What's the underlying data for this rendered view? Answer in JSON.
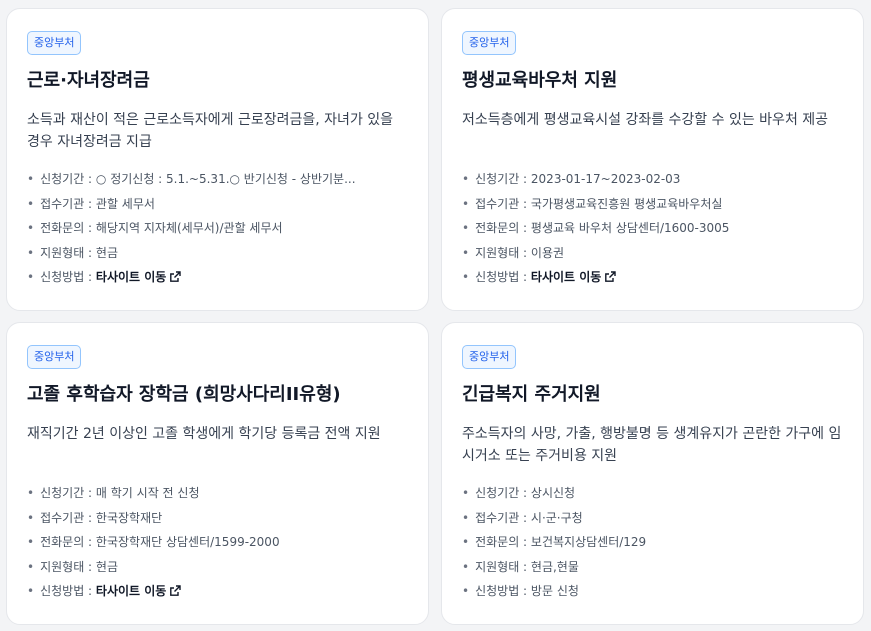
{
  "cards": [
    {
      "badge": "중앙부처",
      "title": "근로·자녀장려금",
      "desc": "소득과 재산이 적은 근로소득자에게 근로장려금을, 자녀가 있을 경우 자녀장려금 지급",
      "period": "신청기간 : ○ 정기신청 : 5.1.~5.31.○ 반기신청 - 상반기분...",
      "agency": "접수기관 : 관할 세무서",
      "phone": "전화문의 : 해당지역 지자체(세무서)/관할 세무서",
      "support": "지원형태 : 현금",
      "method_label": "신청방법 : ",
      "method_value": "타사이트 이동",
      "method_is_link": true
    },
    {
      "badge": "중앙부처",
      "title": "평생교육바우처 지원",
      "desc": "저소득층에게 평생교육시설 강좌를 수강할 수 있는 바우처 제공",
      "period": "신청기간 : 2023-01-17~2023-02-03",
      "agency": "접수기관 : 국가평생교육진흥원 평생교육바우처실",
      "phone": "전화문의 : 평생교육 바우처 상담센터/1600-3005",
      "support": "지원형태 : 이용권",
      "method_label": "신청방법 : ",
      "method_value": "타사이트 이동",
      "method_is_link": true
    },
    {
      "badge": "중앙부처",
      "title": "고졸 후학습자 장학금 (희망사다리II유형)",
      "desc": "재직기간 2년 이상인 고졸 학생에게 학기당 등록금 전액 지원",
      "period": "신청기간 : 매 학기 시작 전 신청",
      "agency": "접수기관 : 한국장학재단",
      "phone": "전화문의 : 한국장학재단 상담센터/1599-2000",
      "support": "지원형태 : 현금",
      "method_label": "신청방법 : ",
      "method_value": "타사이트 이동",
      "method_is_link": true
    },
    {
      "badge": "중앙부처",
      "title": "긴급복지 주거지원",
      "desc": "주소득자의 사망, 가출, 행방불명 등 생계유지가 곤란한 가구에 임시거소 또는 주거비용 지원",
      "period": "신청기간 : 상시신청",
      "agency": "접수기관 : 시·군·구청",
      "phone": "전화문의 : 보건복지상담센터/129",
      "support": "지원형태 : 현금,현물",
      "method_label": "신청방법 : ",
      "method_value": "방문 신청",
      "method_is_link": false
    }
  ],
  "colors": {
    "badge_text": "#2563eb",
    "badge_border": "#93c5fd",
    "title": "#111827",
    "body": "#374151",
    "info": "#4b5563"
  },
  "icons": {
    "external_link": "external-link-icon"
  }
}
